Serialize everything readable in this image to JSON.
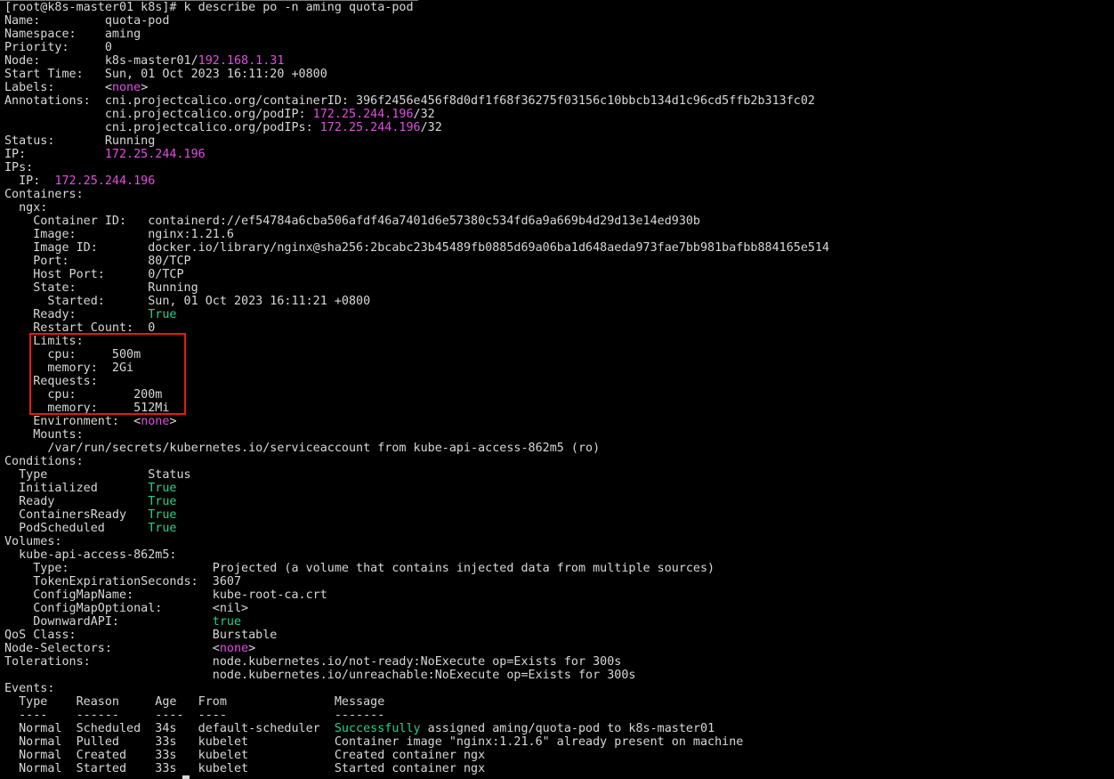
{
  "terminal": {
    "colors": {
      "background": "#000000",
      "text": "#d8d8d8",
      "magenta": "#e34ce3",
      "green": "#23d18b",
      "highlight_box": "#e5191c"
    },
    "prompt": "[root@k8s-master01 k8s]#",
    "command": "k describe po -n aming quota-pod",
    "lines": [
      [
        {
          "t": "[root@k8s-master01 k8s]# k describe po -n aming quota-pod",
          "c": "default"
        }
      ],
      [
        {
          "t": "Name:         quota-pod",
          "c": "default"
        }
      ],
      [
        {
          "t": "Namespace:    aming",
          "c": "default"
        }
      ],
      [
        {
          "t": "Priority:     0",
          "c": "default"
        }
      ],
      [
        {
          "t": "Node:         k8s-master01/",
          "c": "default"
        },
        {
          "t": "192.168.1.31",
          "c": "magenta"
        }
      ],
      [
        {
          "t": "Start Time:   Sun, 01 Oct 2023 16:11:20 +0800",
          "c": "default"
        }
      ],
      [
        {
          "t": "Labels:       <",
          "c": "default"
        },
        {
          "t": "none",
          "c": "magenta"
        },
        {
          "t": ">",
          "c": "default"
        }
      ],
      [
        {
          "t": "Annotations:  cni.projectcalico.org/containerID: 396f2456e456f8d0df1f68f36275f03156c10bbcb134d1c96cd5ffb2b313fc02",
          "c": "default"
        }
      ],
      [
        {
          "t": "              cni.projectcalico.org/podIP: ",
          "c": "default"
        },
        {
          "t": "172.25.244.196",
          "c": "magenta"
        },
        {
          "t": "/32",
          "c": "default"
        }
      ],
      [
        {
          "t": "              cni.projectcalico.org/podIPs: ",
          "c": "default"
        },
        {
          "t": "172.25.244.196",
          "c": "magenta"
        },
        {
          "t": "/32",
          "c": "default"
        }
      ],
      [
        {
          "t": "Status:       Running",
          "c": "default"
        }
      ],
      [
        {
          "t": "IP:           ",
          "c": "default"
        },
        {
          "t": "172.25.244.196",
          "c": "magenta"
        }
      ],
      [
        {
          "t": "IPs:",
          "c": "default"
        }
      ],
      [
        {
          "t": "  IP:  ",
          "c": "default"
        },
        {
          "t": "172.25.244.196",
          "c": "magenta"
        }
      ],
      [
        {
          "t": "Containers:",
          "c": "default"
        }
      ],
      [
        {
          "t": "  ngx:",
          "c": "default"
        }
      ],
      [
        {
          "t": "    Container ID:   containerd://ef54784a6cba506afdf46a7401d6e57380c534fd6a9a669b4d29d13e14ed930b",
          "c": "default"
        }
      ],
      [
        {
          "t": "    Image:          nginx:1.21.6",
          "c": "default"
        }
      ],
      [
        {
          "t": "    Image ID:       docker.io/library/nginx@sha256:2bcabc23b45489fb0885d69a06ba1d648aeda973fae7bb981bafbb884165e514",
          "c": "default"
        }
      ],
      [
        {
          "t": "    Port:           80/TCP",
          "c": "default"
        }
      ],
      [
        {
          "t": "    Host Port:      0/TCP",
          "c": "default"
        }
      ],
      [
        {
          "t": "    State:          Running",
          "c": "default"
        }
      ],
      [
        {
          "t": "      Started:      Sun, 01 Oct 2023 16:11:21 +0800",
          "c": "default"
        }
      ],
      [
        {
          "t": "    Ready:          ",
          "c": "default"
        },
        {
          "t": "True",
          "c": "green"
        }
      ],
      [
        {
          "t": "    Restart Count:  0",
          "c": "default"
        }
      ],
      [
        {
          "t": "    Limits:",
          "c": "default"
        }
      ],
      [
        {
          "t": "      cpu:     500m",
          "c": "default"
        }
      ],
      [
        {
          "t": "      memory:  2Gi",
          "c": "default"
        }
      ],
      [
        {
          "t": "    Requests:",
          "c": "default"
        }
      ],
      [
        {
          "t": "      cpu:        200m",
          "c": "default"
        }
      ],
      [
        {
          "t": "      memory:     512Mi",
          "c": "default"
        }
      ],
      [
        {
          "t": "    Environment:  <",
          "c": "default"
        },
        {
          "t": "none",
          "c": "magenta"
        },
        {
          "t": ">",
          "c": "default"
        }
      ],
      [
        {
          "t": "    Mounts:",
          "c": "default"
        }
      ],
      [
        {
          "t": "      /var/run/secrets/kubernetes.io/serviceaccount from kube-api-access-862m5 (ro)",
          "c": "default"
        }
      ],
      [
        {
          "t": "Conditions:",
          "c": "default"
        }
      ],
      [
        {
          "t": "  Type              Status",
          "c": "default"
        }
      ],
      [
        {
          "t": "  Initialized       ",
          "c": "default"
        },
        {
          "t": "True",
          "c": "green"
        }
      ],
      [
        {
          "t": "  Ready             ",
          "c": "default"
        },
        {
          "t": "True",
          "c": "green"
        }
      ],
      [
        {
          "t": "  ContainersReady   ",
          "c": "default"
        },
        {
          "t": "True",
          "c": "green"
        }
      ],
      [
        {
          "t": "  PodScheduled      ",
          "c": "default"
        },
        {
          "t": "True",
          "c": "green"
        }
      ],
      [
        {
          "t": "Volumes:",
          "c": "default"
        }
      ],
      [
        {
          "t": "  kube-api-access-862m5:",
          "c": "default"
        }
      ],
      [
        {
          "t": "    Type:                    Projected (a volume that contains injected data from multiple sources)",
          "c": "default"
        }
      ],
      [
        {
          "t": "    TokenExpirationSeconds:  3607",
          "c": "default"
        }
      ],
      [
        {
          "t": "    ConfigMapName:           kube-root-ca.crt",
          "c": "default"
        }
      ],
      [
        {
          "t": "    ConfigMapOptional:       <nil>",
          "c": "default"
        }
      ],
      [
        {
          "t": "    DownwardAPI:             ",
          "c": "default"
        },
        {
          "t": "true",
          "c": "green"
        }
      ],
      [
        {
          "t": "QoS Class:                   Burstable",
          "c": "default"
        }
      ],
      [
        {
          "t": "Node-Selectors:              <",
          "c": "default"
        },
        {
          "t": "none",
          "c": "magenta"
        },
        {
          "t": ">",
          "c": "default"
        }
      ],
      [
        {
          "t": "Tolerations:                 node.kubernetes.io/not-ready:NoExecute op=Exists for 300s",
          "c": "default"
        }
      ],
      [
        {
          "t": "                             node.kubernetes.io/unreachable:NoExecute op=Exists for 300s",
          "c": "default"
        }
      ],
      [
        {
          "t": "Events:",
          "c": "default"
        }
      ],
      [
        {
          "t": "  Type    Reason     Age   From               Message",
          "c": "default"
        }
      ],
      [
        {
          "t": "  ----    ------     ----  ----               -------",
          "c": "default"
        }
      ],
      [
        {
          "t": "  Normal  Scheduled  34s   default-scheduler  ",
          "c": "default"
        },
        {
          "t": "Successfully",
          "c": "green"
        },
        {
          "t": " assigned aming/quota-pod to k8s-master01",
          "c": "default"
        }
      ],
      [
        {
          "t": "  Normal  Pulled     33s   kubelet            Container image \"nginx:1.21.6\" already present on machine",
          "c": "default"
        }
      ],
      [
        {
          "t": "  Normal  Created    33s   kubelet            Created container ngx",
          "c": "default"
        }
      ],
      [
        {
          "t": "  Normal  Started    33s   kubelet            Started container ngx",
          "c": "default"
        }
      ]
    ]
  }
}
